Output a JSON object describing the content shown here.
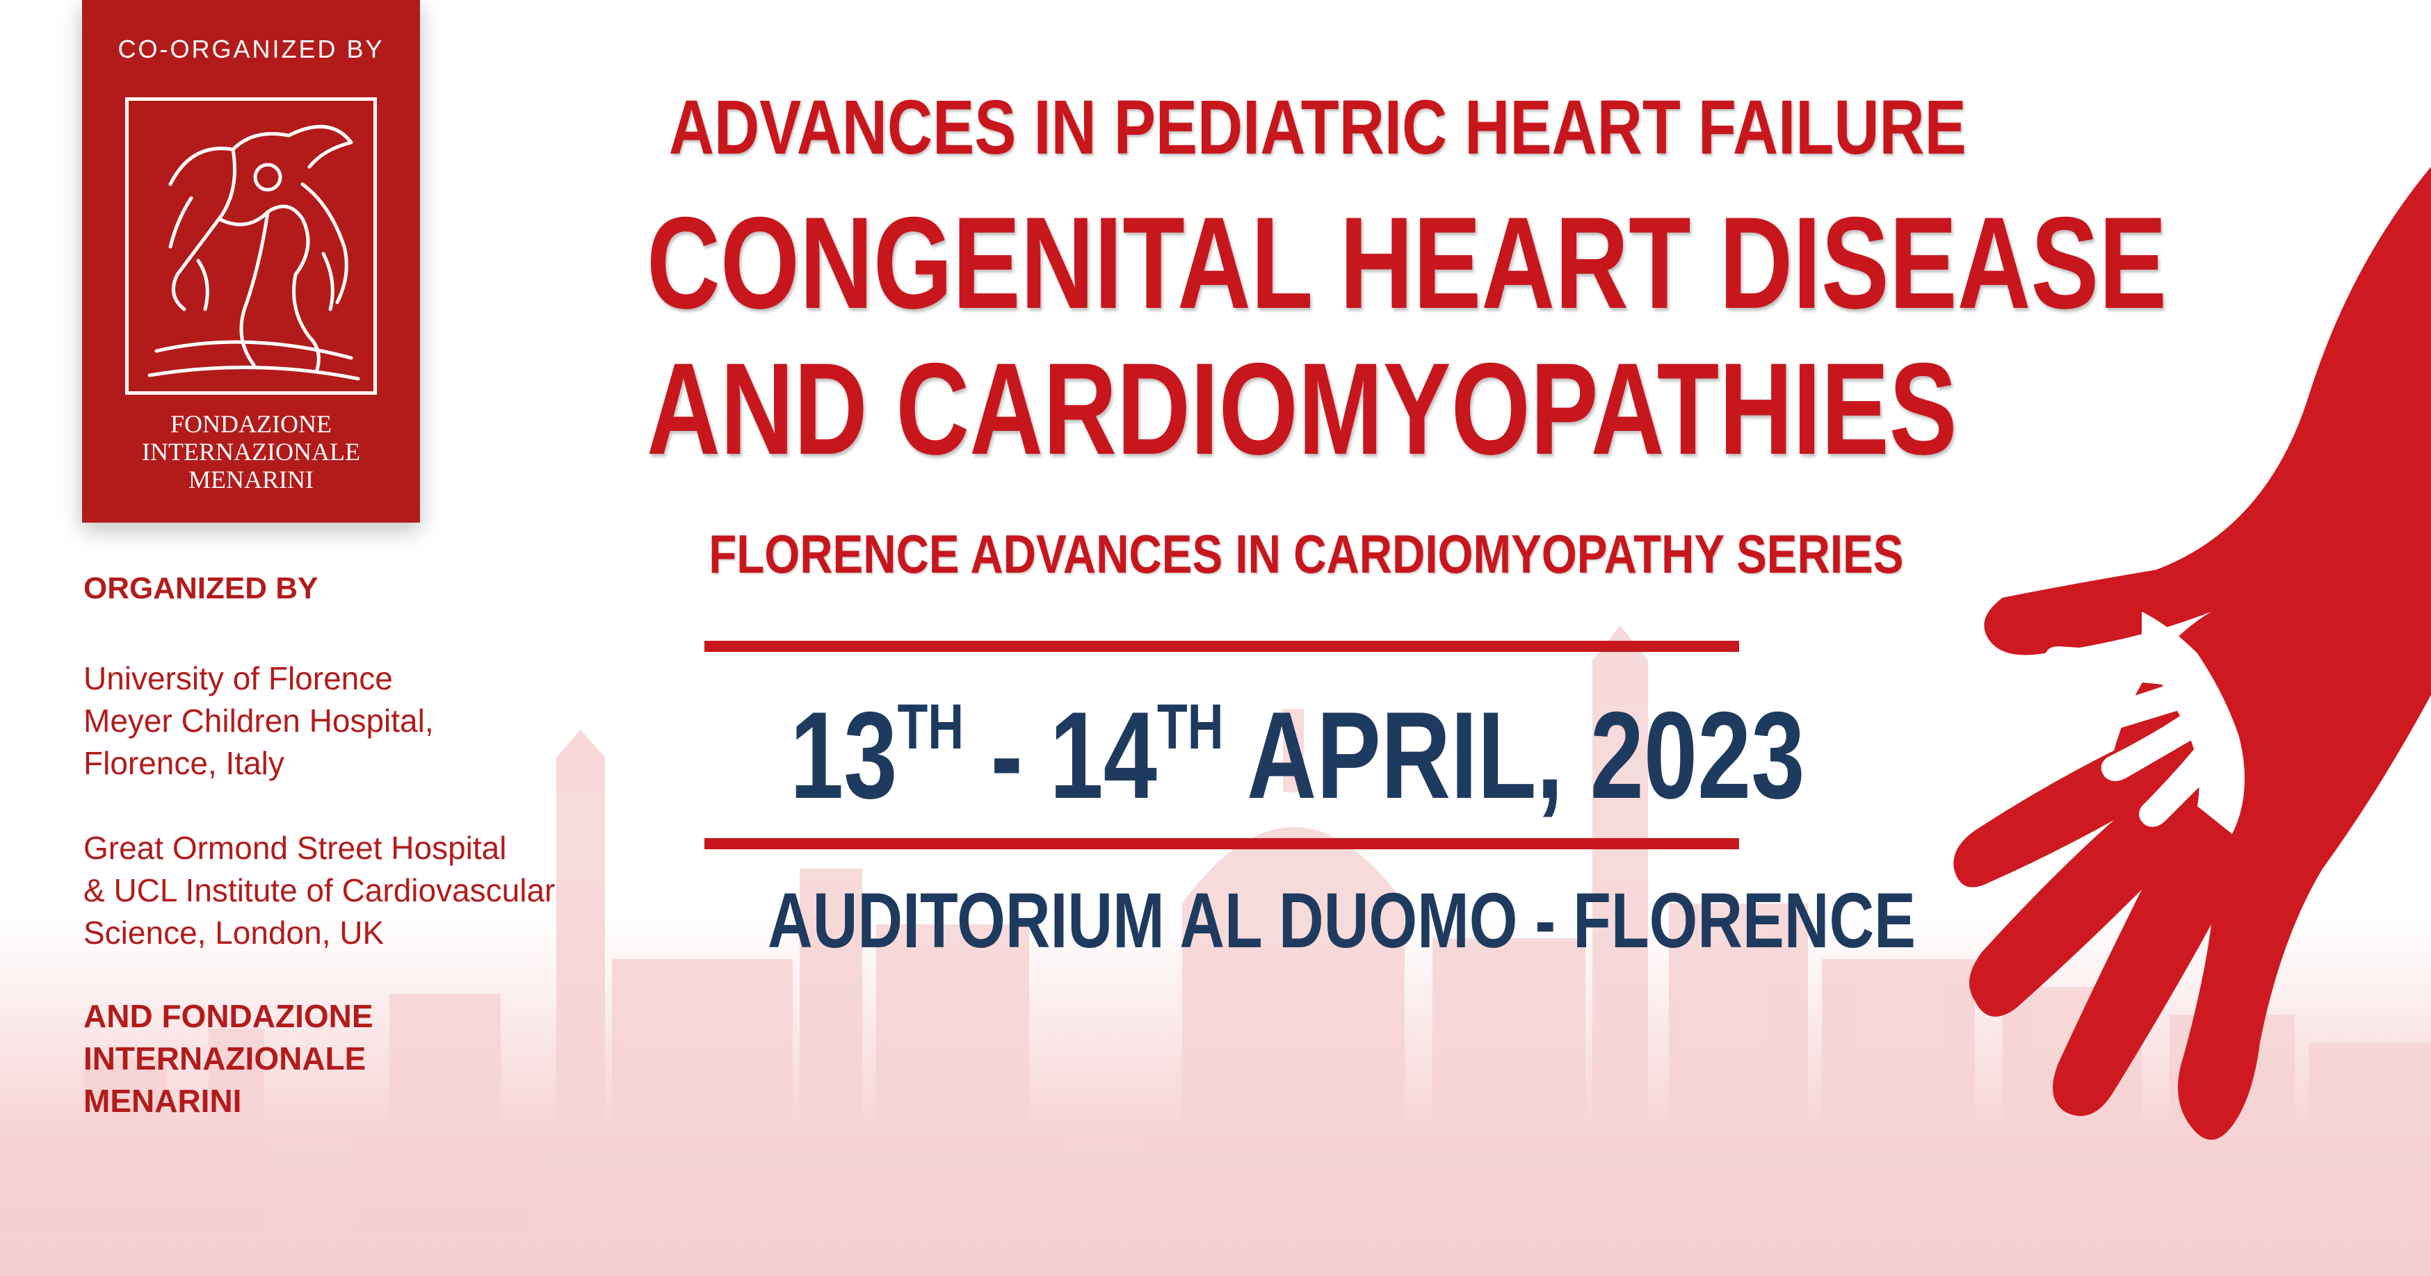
{
  "logo": {
    "co_organized": "CO-ORGANIZED BY",
    "foundation_lines": [
      "FONDAZIONE",
      "INTERNAZIONALE",
      "MENARINI"
    ]
  },
  "organizers": {
    "heading": "ORGANIZED BY",
    "group1": [
      "University of Florence",
      "Meyer Children Hospital,",
      "Florence, Italy"
    ],
    "group2": [
      "Great Ormond Street Hospital",
      "& UCL Institute of Cardiovascular",
      "Science, London, UK"
    ],
    "group3": [
      "AND FONDAZIONE",
      "INTERNAZIONALE",
      "MENARINI"
    ]
  },
  "title": {
    "line1": "ADVANCES IN PEDIATRIC HEART FAILURE",
    "line2": "CONGENITAL HEART DISEASE",
    "line3": "AND CARDIOMYOPATHIES"
  },
  "series": "FLORENCE ADVANCES IN CARDIOMYOPATHY SERIES",
  "date": {
    "day1": "13",
    "sup1": "TH",
    "sep": " - ",
    "day2": "14",
    "sup2": "TH",
    "rest": " APRIL, 2023"
  },
  "venue": "AUDITORIUM AL DUOMO - FLORENCE",
  "colors": {
    "brand_red": "#c8161d",
    "logo_red": "#b31b1b",
    "navy": "#1f3a5f"
  },
  "icons": {
    "emblem": "winged-figure-horse-emblem",
    "hands": "adult-child-hands-illustration",
    "skyline": "florence-skyline-silhouette"
  }
}
